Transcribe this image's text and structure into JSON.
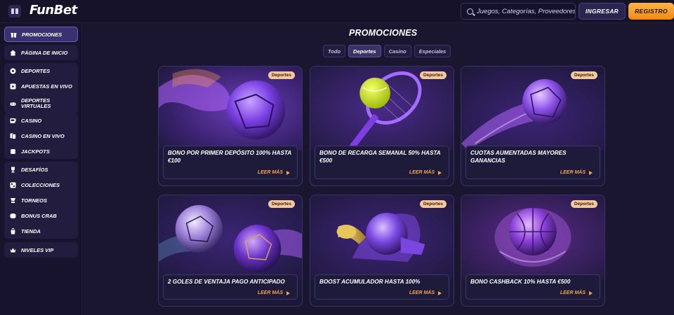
{
  "brand": {
    "logo": "FunBet"
  },
  "header": {
    "search_placeholder": "Juegos, Categorías, Proveedores",
    "login_label": "INGRESAR",
    "register_label": "REGISTRO"
  },
  "sidebar": {
    "groups": [
      {
        "items": [
          {
            "label": "PROMOCIONES",
            "icon": "gift-icon",
            "active": true
          }
        ]
      },
      {
        "items": [
          {
            "label": "PÁGINA DE INICIO",
            "icon": "home-icon"
          }
        ]
      },
      {
        "items": [
          {
            "label": "DEPORTES",
            "icon": "soccer-ball-icon"
          },
          {
            "label": "APUESTAS EN VIVO",
            "icon": "play-icon"
          },
          {
            "label": "DEPORTES VIRTUALES",
            "icon": "gamepad-icon"
          }
        ]
      },
      {
        "items": [
          {
            "label": "CASINO",
            "icon": "slot-machine-icon"
          },
          {
            "label": "CASINO EN VIVO",
            "icon": "live-casino-icon"
          },
          {
            "label": "JACKPOTS",
            "icon": "clover-icon"
          }
        ]
      },
      {
        "items": [
          {
            "label": "DESAFÍOS",
            "icon": "trophy-icon"
          },
          {
            "label": "COLECCIONES",
            "icon": "collection-icon"
          },
          {
            "label": "TORNEOS",
            "icon": "tournament-icon"
          },
          {
            "label": "BONUS CRAB",
            "icon": "coin-icon"
          },
          {
            "label": "TIENDA",
            "icon": "shop-icon"
          }
        ]
      },
      {
        "items": [
          {
            "label": "NIVELES VIP",
            "icon": "crown-icon"
          }
        ]
      }
    ]
  },
  "main": {
    "title": "PROMOCIONES",
    "tabs": [
      "Todo",
      "Deportes",
      "Casino",
      "Especiales"
    ],
    "active_tab": "Deportes",
    "read_more": "LEER MÁS",
    "cards": [
      {
        "badge": "Deportes",
        "title": "BONO POR PRIMER DEPÓSITO 100% HASTA €100",
        "art": "soccer-ball-art"
      },
      {
        "badge": "Deportes",
        "title": "BONO DE RECARGA SEMANAL 50% HASTA €500",
        "art": "tennis-art"
      },
      {
        "badge": "Deportes",
        "title": "CUOTAS AUMENTADAS MAYORES GANANCIAS",
        "art": "speed-ball-art"
      },
      {
        "badge": "Deportes",
        "title": "2 GOLES DE VENTAJA PAGO ANTICIPADO",
        "art": "two-balls-art"
      },
      {
        "badge": "Deportes",
        "title": "BOOST ACUMULADOR HASTA 100%",
        "art": "trophy-horn-art"
      },
      {
        "badge": "Deportes",
        "title": "BONO CASHBACK 10% HASTA €500",
        "art": "basketball-art"
      }
    ]
  },
  "colors": {
    "background": "#1a1630",
    "accent_orange": "#f18a14",
    "link_orange": "#f0a44b",
    "badge": "#f3c9a0",
    "purple": "#7b3fe4"
  }
}
